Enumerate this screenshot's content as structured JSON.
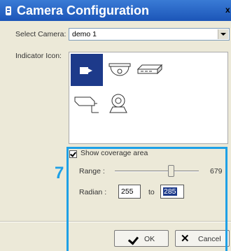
{
  "window": {
    "title": "Camera Configuration",
    "close_glyph": "x"
  },
  "form": {
    "select_camera_label": "Select Camera:",
    "select_camera_value": "demo 1",
    "indicator_icon_label": "Indicator Icon:",
    "icons": [
      "camera-icon",
      "dome-camera-icon",
      "dvr-box-icon",
      "bullet-camera-icon",
      "ptz-camera-icon"
    ],
    "selected_icon": "camera-icon"
  },
  "coverage": {
    "show_label": "Show coverage area",
    "checked": true,
    "range_label": "Range :",
    "range_value": "679",
    "radian_label": "Radian :",
    "radian_from": "255",
    "radian_to_label": "to",
    "radian_to": "285"
  },
  "buttons": {
    "ok_label": "OK",
    "cancel_label": "Cancel"
  },
  "annotation": {
    "step_number": "7",
    "highlight_color": "#1ea0e6"
  },
  "colors": {
    "titlebar": "#1c55b8",
    "selected_icon_bg": "#1d3a8a"
  }
}
